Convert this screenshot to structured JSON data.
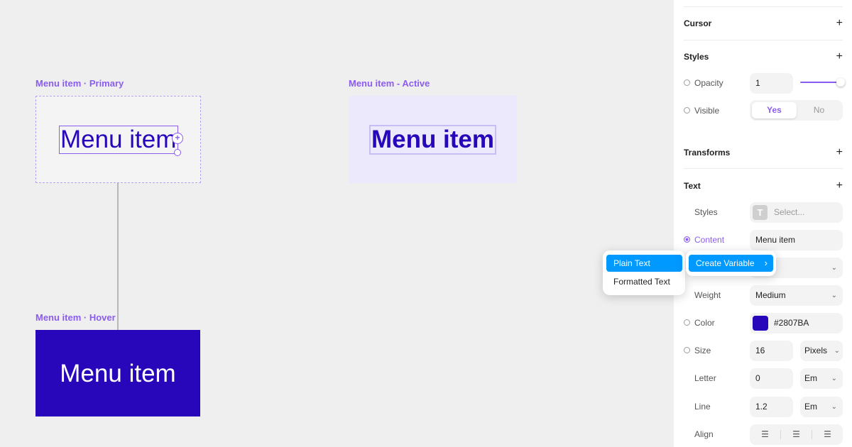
{
  "canvas": {
    "frame_primary_label": "Menu item · Primary",
    "frame_active_label": "Menu item - Active",
    "frame_hover_label": "Menu item · Hover",
    "menu_item_text": "Menu item"
  },
  "context_menu": {
    "plain_text": "Plain Text",
    "formatted_text": "Formatted Text",
    "create_variable": "Create Variable"
  },
  "panel": {
    "cursor": {
      "title": "Cursor"
    },
    "styles": {
      "title": "Styles",
      "opacity_label": "Opacity",
      "opacity_value": "1",
      "visible_label": "Visible",
      "visible_yes": "Yes",
      "visible_no": "No"
    },
    "transforms": {
      "title": "Transforms"
    },
    "text": {
      "title": "Text",
      "styles_label": "Styles",
      "styles_placeholder": "Select...",
      "content_label": "Content",
      "content_value": "Menu item",
      "weight_label": "Weight",
      "weight_value": "Medium",
      "color_label": "Color",
      "color_value": "#2807BA",
      "size_label": "Size",
      "size_value": "16",
      "size_unit": "Pixels",
      "letter_label": "Letter",
      "letter_value": "0",
      "letter_unit": "Em",
      "line_label": "Line",
      "line_value": "1.2",
      "line_unit": "Em",
      "align_label": "Align"
    }
  },
  "colors": {
    "accent": "#8b5cf0",
    "brand": "#2807ba",
    "menu_highlight": "#0099ff"
  }
}
